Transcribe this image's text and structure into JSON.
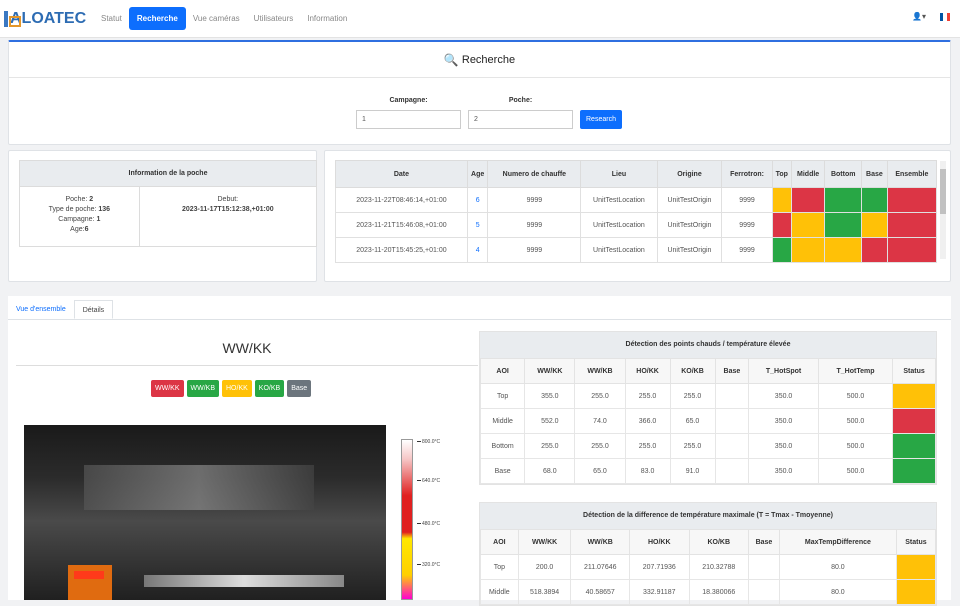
{
  "brand": {
    "name": "ALOATEC"
  },
  "nav": {
    "items": [
      {
        "label": "Statut",
        "active": false
      },
      {
        "label": "Recherche",
        "active": true
      },
      {
        "label": "Vue caméras",
        "active": false
      },
      {
        "label": "Utilisateurs",
        "active": false
      },
      {
        "label": "Information",
        "active": false
      }
    ],
    "user_icon": "user-icon",
    "lang_flag": "fr-flag"
  },
  "search": {
    "title": "Recherche",
    "campagne_label": "Campagne:",
    "campagne_value": "1",
    "poche_label": "Poche:",
    "poche_value": "2",
    "button": "Research"
  },
  "poche_info": {
    "title": "Information de la poche",
    "poche_label": "Poche:",
    "poche": "2",
    "type_label": "Type de poche:",
    "type": "136",
    "campagne_label": "Campagne:",
    "campagne": "1",
    "age_label": "Age:",
    "age": "6",
    "debut_label": "Debut:",
    "debut": "2023-11-17T15:12:38,+01:00"
  },
  "history": {
    "headers": [
      "Date",
      "Age",
      "Numero de chauffe",
      "Lieu",
      "Origine",
      "Ferrotron:",
      "Top",
      "Middle",
      "Bottom",
      "Base",
      "Ensemble"
    ],
    "rows": [
      {
        "date": "2023-11-22T08:46:14,+01:00",
        "age": "6",
        "chauffe": "9999",
        "lieu": "UnitTestLocation",
        "origine": "UnitTestOrigin",
        "ferrotron": "9999",
        "status": [
          "orange",
          "red",
          "green",
          "green",
          "red"
        ]
      },
      {
        "date": "2023-11-21T15:46:08,+01:00",
        "age": "5",
        "chauffe": "9999",
        "lieu": "UnitTestLocation",
        "origine": "UnitTestOrigin",
        "ferrotron": "9999",
        "status": [
          "red",
          "orange",
          "green",
          "orange",
          "red"
        ]
      },
      {
        "date": "2023-11-20T15:45:25,+01:00",
        "age": "4",
        "chauffe": "9999",
        "lieu": "UnitTestLocation",
        "origine": "UnitTestOrigin",
        "ferrotron": "9999",
        "status": [
          "green",
          "orange",
          "orange",
          "red",
          "red"
        ]
      }
    ]
  },
  "tabs": [
    {
      "label": "Vue d'ensemble",
      "active": false
    },
    {
      "label": "Détails",
      "active": true
    }
  ],
  "image_panel": {
    "title": "WW/KK",
    "legend": [
      {
        "label": "WW/KK",
        "color": "#dc3545"
      },
      {
        "label": "WW/KB",
        "color": "#28a745"
      },
      {
        "label": "HO/KK",
        "color": "#ffc107"
      },
      {
        "label": "KO/KB",
        "color": "#28a745"
      },
      {
        "label": "Base",
        "color": "#6c757d"
      }
    ],
    "scale": [
      "800.0°C",
      "640.0°C",
      "480.0°C",
      "320.0°C"
    ]
  },
  "hotspot_table": {
    "title": "Détection des points chauds / température élevée",
    "headers": [
      "AOI",
      "WW/KK",
      "WW/KB",
      "HO/KK",
      "KO/KB",
      "Base",
      "T_HotSpot",
      "T_HotTemp",
      "Status"
    ],
    "rows": [
      {
        "cells": [
          "Top",
          "355.0",
          "255.0",
          "255.0",
          "255.0",
          "",
          "350.0",
          "500.0"
        ],
        "status": "orange"
      },
      {
        "cells": [
          "Middle",
          "552.0",
          "74.0",
          "366.0",
          "65.0",
          "",
          "350.0",
          "500.0"
        ],
        "status": "red"
      },
      {
        "cells": [
          "Bottom",
          "255.0",
          "255.0",
          "255.0",
          "255.0",
          "",
          "350.0",
          "500.0"
        ],
        "status": "green"
      },
      {
        "cells": [
          "Base",
          "68.0",
          "65.0",
          "83.0",
          "91.0",
          "",
          "350.0",
          "500.0"
        ],
        "status": "green"
      }
    ]
  },
  "diff_table": {
    "title": "Détection de la difference de température maximale (T = Tmax - Tmoyenne)",
    "headers": [
      "AOI",
      "WW/KK",
      "WW/KB",
      "HO/KK",
      "KO/KB",
      "Base",
      "MaxTempDifference",
      "Status"
    ],
    "rows": [
      {
        "cells": [
          "Top",
          "200.0",
          "211.07646",
          "207.71936",
          "210.32788",
          "",
          "80.0"
        ],
        "status": "orange"
      },
      {
        "cells": [
          "Middle",
          "518.3894",
          "40.58657",
          "332.91187",
          "18.380066",
          "",
          "80.0"
        ],
        "status": "orange"
      }
    ]
  },
  "colors": {
    "red": "#dc3545",
    "green": "#28a745",
    "orange": "#ffc107",
    "accent": "#0d6efd"
  }
}
